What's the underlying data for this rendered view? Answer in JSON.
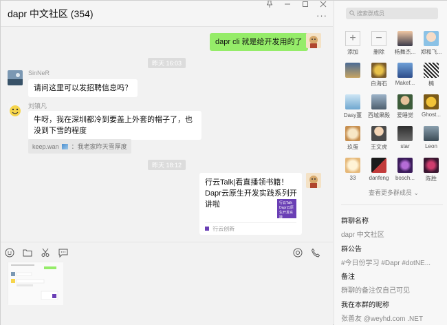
{
  "chat": {
    "title": "dapr 中文社区 (354)",
    "more_icon": "more-dots-icon",
    "window_buttons": [
      "pin-icon",
      "minimize-icon",
      "maximize-icon",
      "close-icon"
    ]
  },
  "messages": {
    "m1": {
      "text": "dapr cli 就是给开发用的了"
    },
    "time1": "昨天 16:03",
    "m2": {
      "sender": "SinNeR",
      "text": "请问这里可以发招聘信息吗？"
    },
    "m3": {
      "sender": "刘镇凡",
      "text": "牛呀，我在深圳都冷到要盖上外套的帽子了，也没到下雪的程度"
    },
    "quote": {
      "author": "keep.wan",
      "text": "：我老家昨天雪厚度"
    },
    "time2": "昨天 18:12",
    "card": {
      "text": "行云Talk|看直播领书籍！Dapr云原生开发实践系列开讲啦",
      "thumb_text": "行云Talk Dapr云原生开发实践",
      "source": "行云创新"
    }
  },
  "toolbar": {
    "icons": [
      "emoji-icon",
      "folder-icon",
      "scissors-icon",
      "chat-bubble-icon"
    ],
    "right_icons": [
      "voice-call-icon",
      "video-call-icon"
    ]
  },
  "panel": {
    "search_placeholder": "搜索群成员",
    "add_label": "添加",
    "remove_label": "删除",
    "members": [
      "杨舞杰...",
      "郑和飞...",
      "",
      "白海石",
      "Makef...",
      "楠",
      "Dasy董",
      "西城果殿",
      "爱睡觉",
      "Ghost...",
      "玖蛋",
      "王文虎",
      "star",
      "Leon",
      "33",
      "danfeng",
      "bosch...",
      "陈胜"
    ],
    "more_members": "查看更多群成员",
    "group_name_label": "群聊名称",
    "group_name_value": "dapr 中文社区",
    "announcement_label": "群公告",
    "announcement_value": "#今日份学习 #Dapr #dotNE...",
    "remark_label": "备注",
    "remark_value": "群聊的备注仅自己可见",
    "nickname_label": "我在本群的昵称",
    "nickname_value": "张善友 @weyhd.com .NET"
  }
}
